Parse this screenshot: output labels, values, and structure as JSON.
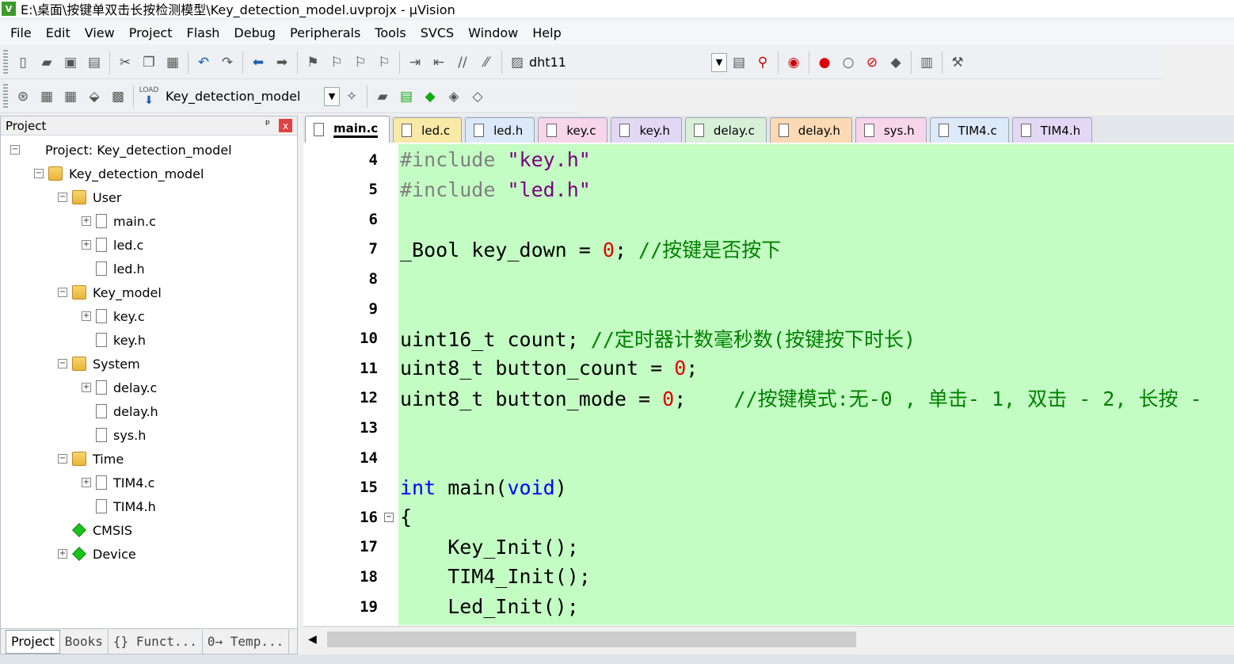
{
  "window": {
    "title": "E:\\桌面\\按键单双击长按检测模型\\Key_detection_model.uvprojx - µVision",
    "logo": "V"
  },
  "menu": [
    "File",
    "Edit",
    "View",
    "Project",
    "Flash",
    "Debug",
    "Peripherals",
    "Tools",
    "SVCS",
    "Window",
    "Help"
  ],
  "toolbar1": {
    "icons": [
      "new-file-icon",
      "open-folder-icon",
      "save-icon",
      "save-all-icon",
      "cut-icon",
      "copy-icon",
      "paste-icon",
      "undo-icon",
      "redo-icon",
      "nav-back-icon",
      "nav-forward-icon",
      "bookmark-icon",
      "bookmark-prev-icon",
      "bookmark-next-icon",
      "bookmark-clear-icon",
      "indent-icon",
      "unindent-icon",
      "comment-icon",
      "uncomment-icon",
      "find-in-files-icon"
    ],
    "find_value": "dht11",
    "right_icons": [
      "incremental-find-icon",
      "find-icon",
      "debug-session-icon",
      "breakpoint-icon",
      "breakpoint-disable-icon",
      "breakpoint-kill-icon",
      "breakpoint-disable-all-icon",
      "window-layout-icon",
      "configure-icon"
    ]
  },
  "toolbar2": {
    "icons": [
      "translate-icon",
      "build-icon",
      "rebuild-icon",
      "batch-build-icon",
      "stop-build-icon",
      "load-icon"
    ],
    "load_label": "LOAD",
    "target": "Key_detection_model",
    "right_icons": [
      "target-options-icon",
      "file-extensions-icon",
      "manage-rte-icon",
      "select-pack-icon",
      "pack-installer-icon",
      "event-recorder-icon"
    ]
  },
  "project_pane": {
    "title": "Project",
    "pin": "ᵖ",
    "close": "x",
    "tree": [
      {
        "label": "Project: Key_detection_model",
        "level": 0,
        "expander": "⊟",
        "icon": "project"
      },
      {
        "label": "Key_detection_model",
        "level": 1,
        "expander": "⊟",
        "icon": "folder"
      },
      {
        "label": "User",
        "level": 2,
        "expander": "⊟",
        "icon": "folder"
      },
      {
        "label": "main.c",
        "level": 3,
        "expander": "⊞",
        "icon": "file"
      },
      {
        "label": "led.c",
        "level": 3,
        "expander": "⊞",
        "icon": "file"
      },
      {
        "label": "led.h",
        "level": 3,
        "expander": "",
        "icon": "file"
      },
      {
        "label": "Key_model",
        "level": 2,
        "expander": "⊟",
        "icon": "folder"
      },
      {
        "label": "key.c",
        "level": 3,
        "expander": "⊞",
        "icon": "file"
      },
      {
        "label": "key.h",
        "level": 3,
        "expander": "",
        "icon": "file"
      },
      {
        "label": "System",
        "level": 2,
        "expander": "⊟",
        "icon": "folder"
      },
      {
        "label": "delay.c",
        "level": 3,
        "expander": "⊞",
        "icon": "file"
      },
      {
        "label": "delay.h",
        "level": 3,
        "expander": "",
        "icon": "file"
      },
      {
        "label": "sys.h",
        "level": 3,
        "expander": "",
        "icon": "file"
      },
      {
        "label": "Time",
        "level": 2,
        "expander": "⊟",
        "icon": "folder"
      },
      {
        "label": "TIM4.c",
        "level": 3,
        "expander": "⊞",
        "icon": "file"
      },
      {
        "label": "TIM4.h",
        "level": 3,
        "expander": "",
        "icon": "file"
      },
      {
        "label": "CMSIS",
        "level": 2,
        "expander": "",
        "icon": "gem"
      },
      {
        "label": "Device",
        "level": 2,
        "expander": "⊞",
        "icon": "gem"
      }
    ],
    "bottom_tabs": [
      "Project",
      "Books",
      "{} Funct...",
      "0→ Temp..."
    ]
  },
  "editor": {
    "tabs": [
      {
        "label": "main.c",
        "color": "#ffffff"
      },
      {
        "label": "led.c",
        "color": "#f9e9a6"
      },
      {
        "label": "led.h",
        "color": "#dce9f8"
      },
      {
        "label": "key.c",
        "color": "#f7d6ea"
      },
      {
        "label": "key.h",
        "color": "#e3d8f4"
      },
      {
        "label": "delay.c",
        "color": "#d8efd8"
      },
      {
        "label": "delay.h",
        "color": "#fbd9b4"
      },
      {
        "label": "sys.h",
        "color": "#f7d6ea"
      },
      {
        "label": "TIM4.c",
        "color": "#dce9f8"
      },
      {
        "label": "TIM4.h",
        "color": "#e3d8f4"
      }
    ],
    "lines": [
      {
        "num": "4",
        "fold": "",
        "segs": [
          [
            "pp",
            "#include "
          ],
          [
            "str",
            "\"key.h\""
          ]
        ]
      },
      {
        "num": "5",
        "fold": "",
        "segs": [
          [
            "pp",
            "#include "
          ],
          [
            "str",
            "\"led.h\""
          ]
        ]
      },
      {
        "num": "6",
        "fold": "",
        "segs": []
      },
      {
        "num": "7",
        "fold": "",
        "segs": [
          [
            "",
            "_Bool key_down = "
          ],
          [
            "num",
            "0"
          ],
          [
            "",
            "; "
          ],
          [
            "cmt",
            "//按键是否按下"
          ]
        ]
      },
      {
        "num": "8",
        "fold": "",
        "segs": []
      },
      {
        "num": "9",
        "fold": "",
        "segs": []
      },
      {
        "num": "10",
        "fold": "",
        "segs": [
          [
            "",
            "uint16_t count; "
          ],
          [
            "cmt",
            "//定时器计数毫秒数(按键按下时长)"
          ]
        ]
      },
      {
        "num": "11",
        "fold": "",
        "segs": [
          [
            "",
            "uint8_t button_count = "
          ],
          [
            "num",
            "0"
          ],
          [
            "",
            ";"
          ]
        ]
      },
      {
        "num": "12",
        "fold": "",
        "segs": [
          [
            "",
            "uint8_t button_mode = "
          ],
          [
            "num",
            "0"
          ],
          [
            "",
            ";    "
          ],
          [
            "cmt",
            "//按键模式:无-0 , 单击- 1, 双击 - 2, 长按 -"
          ]
        ]
      },
      {
        "num": "13",
        "fold": "",
        "segs": []
      },
      {
        "num": "14",
        "fold": "",
        "segs": []
      },
      {
        "num": "15",
        "fold": "",
        "segs": [
          [
            "kw",
            "int"
          ],
          [
            "",
            " main("
          ],
          [
            "kw",
            "void"
          ],
          [
            "",
            ")"
          ]
        ]
      },
      {
        "num": "16",
        "fold": "⊟",
        "segs": [
          [
            "",
            "{"
          ]
        ]
      },
      {
        "num": "17",
        "fold": "",
        "segs": [
          [
            "",
            "    Key_Init();"
          ]
        ]
      },
      {
        "num": "18",
        "fold": "",
        "segs": [
          [
            "",
            "    TIM4_Init();"
          ]
        ]
      },
      {
        "num": "19",
        "fold": "",
        "segs": [
          [
            "",
            "    Led_Init();"
          ]
        ]
      }
    ]
  }
}
